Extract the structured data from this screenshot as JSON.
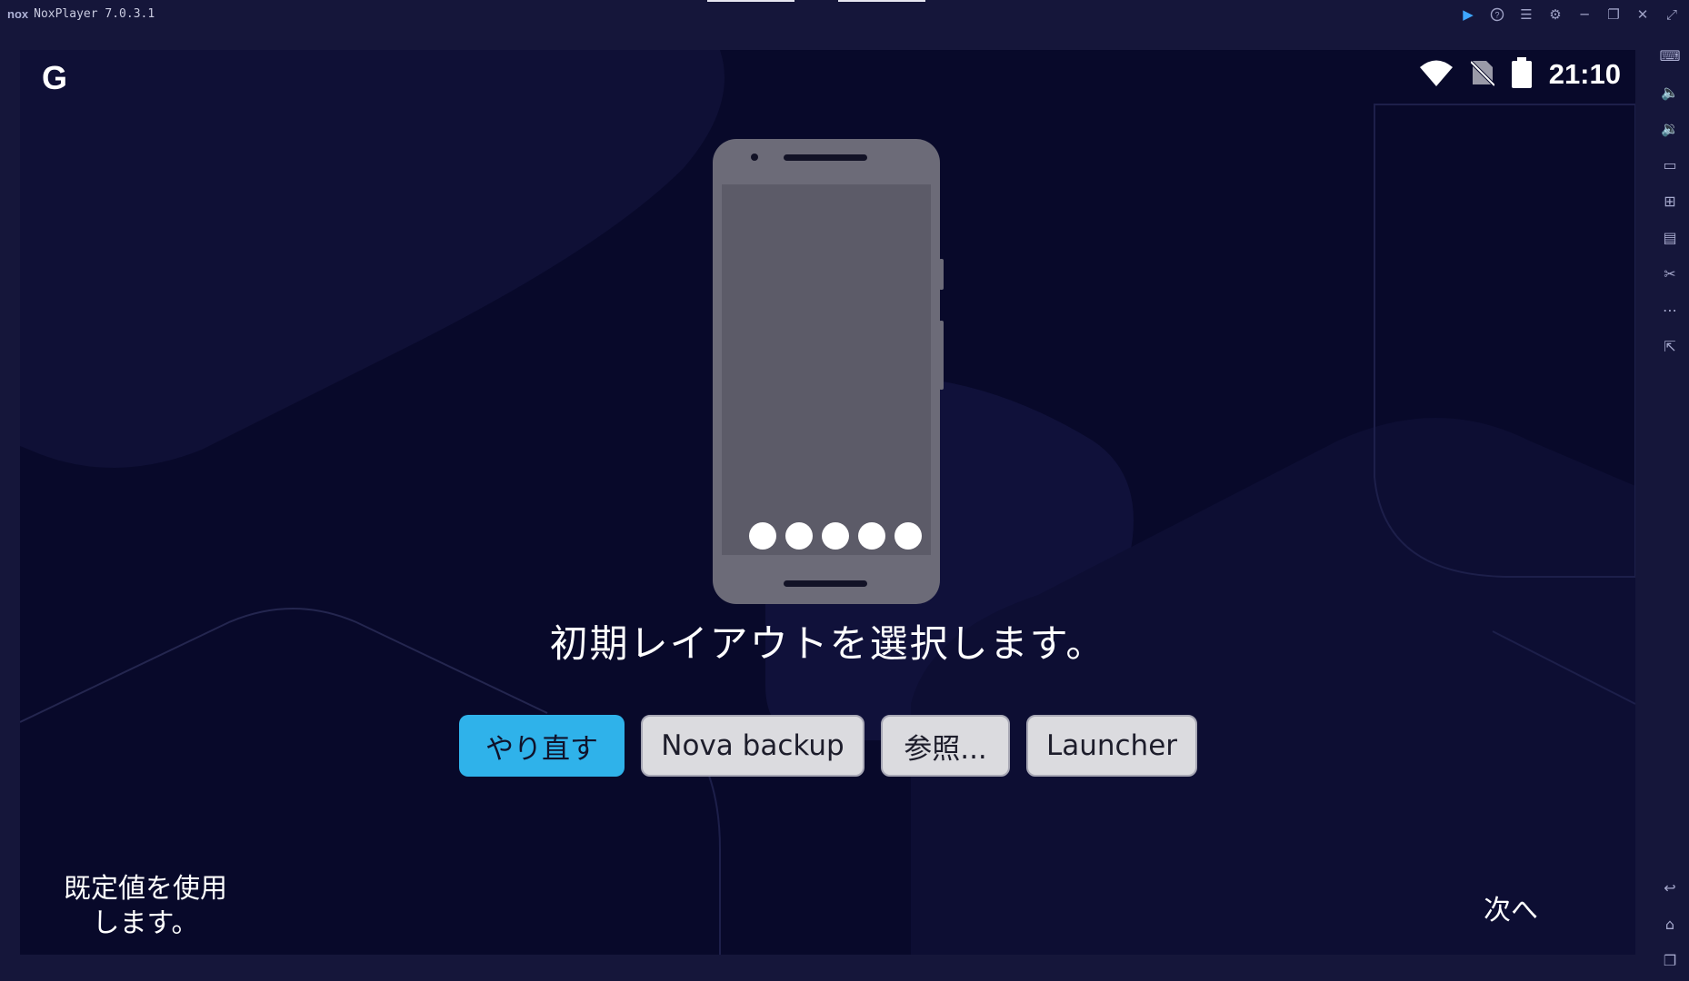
{
  "window": {
    "app_title": "NoxPlayer 7.0.3.1",
    "logo_text": "nox",
    "controls": [
      "play-icon",
      "help-icon",
      "menu-icon",
      "settings-icon",
      "minimize-icon",
      "restore-icon",
      "close-icon",
      "fullscreen-icon"
    ]
  },
  "sidebar": {
    "icons": [
      "keyboard-icon",
      "volume-up-icon",
      "volume-down-icon",
      "screen-icon",
      "apk-install-icon",
      "multi-instance-icon",
      "scissors-icon",
      "more-icon",
      "external-icon",
      "back-icon",
      "home-icon",
      "recent-apps-icon"
    ]
  },
  "status_bar": {
    "logo": "G",
    "time": "21:10",
    "icons": [
      "wifi-icon",
      "no-sim-icon",
      "battery-icon"
    ]
  },
  "dialog": {
    "heading": "初期レイアウトを選択します。",
    "buttons": [
      {
        "label": "やり直す",
        "style": "primary"
      },
      {
        "label": "Nova backup",
        "style": "secondary"
      },
      {
        "label": "参照...",
        "style": "secondary"
      },
      {
        "label": "Launcher",
        "style": "secondary"
      }
    ],
    "page_dots": 5
  },
  "footer": {
    "left_label": "既定値を使用します。",
    "right_label": "次へ"
  },
  "colors": {
    "window_bg": "#15163a",
    "screen_bg": "#08092a",
    "accent": "#2fb2ea",
    "phone_body": "#6c6b78"
  }
}
